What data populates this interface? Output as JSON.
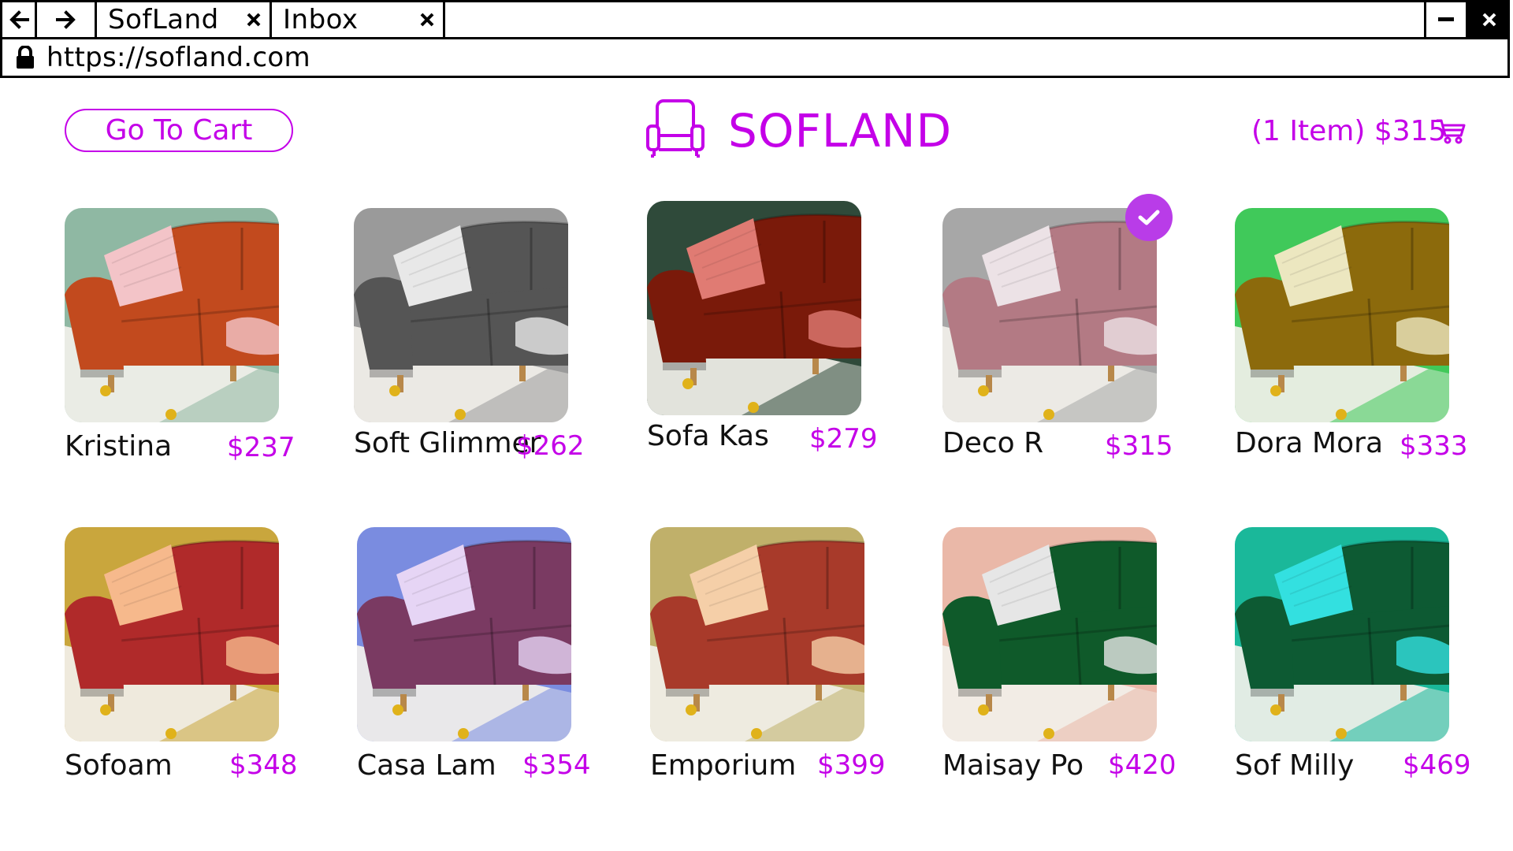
{
  "browser": {
    "tabs": [
      {
        "title": "SofLand"
      },
      {
        "title": "Inbox"
      }
    ],
    "url": "https://sofland.com",
    "icons": {
      "back": "arrow-left-icon",
      "forward": "arrow-right-icon",
      "close": "close-icon",
      "minimize": "minimize-icon",
      "lock": "lock-icon"
    }
  },
  "header": {
    "go_to_cart_label": "Go To Cart",
    "brand": "SOFLAND",
    "brand_icon": "armchair-icon",
    "cart_summary": "(1 Item) $315",
    "cart_icon": "cart-icon"
  },
  "colors": {
    "accent": "#c400e8",
    "check_badge": "#b93ce8"
  },
  "products": [
    {
      "name": "Kristina",
      "price": "$237",
      "sofa": "#c24a1e",
      "bg": "#8fb8a3",
      "pillow": "#f3c4c8",
      "selected": false
    },
    {
      "name": "Soft Glimmer",
      "price": "$262",
      "sofa": "#555555",
      "bg": "#9a9a9a",
      "pillow": "#e8e8e8",
      "selected": false
    },
    {
      "name": "Sofa Kas",
      "price": "$279",
      "sofa": "#7a1a0a",
      "bg": "#2f4a3a",
      "pillow": "#e07b73",
      "selected": false
    },
    {
      "name": "Deco R",
      "price": "$315",
      "sofa": "#b37a84",
      "bg": "#a7a7a7",
      "pillow": "#ece2e6",
      "selected": true
    },
    {
      "name": "Dora Mora",
      "price": "$333",
      "sofa": "#8c6a0c",
      "bg": "#40c95a",
      "pillow": "#ece7c0",
      "selected": false
    },
    {
      "name": "Sofoam",
      "price": "$348",
      "sofa": "#b02a2a",
      "bg": "#c9a63d",
      "pillow": "#f6b98c",
      "selected": false
    },
    {
      "name": "Casa Lam",
      "price": "$354",
      "sofa": "#7a3a62",
      "bg": "#7a8ce0",
      "pillow": "#e6d5f5",
      "selected": false
    },
    {
      "name": "Emporium",
      "price": "$399",
      "sofa": "#a83a2a",
      "bg": "#c0b06a",
      "pillow": "#f5cfa8",
      "selected": false
    },
    {
      "name": "Maisay Po",
      "price": "$420",
      "sofa": "#0f5a2a",
      "bg": "#eab8a8",
      "pillow": "#e6e6e6",
      "selected": false
    },
    {
      "name": "Sof Milly",
      "price": "$469",
      "sofa": "#0d5a33",
      "bg": "#1ab89a",
      "pillow": "#33e0e0",
      "selected": false
    }
  ]
}
